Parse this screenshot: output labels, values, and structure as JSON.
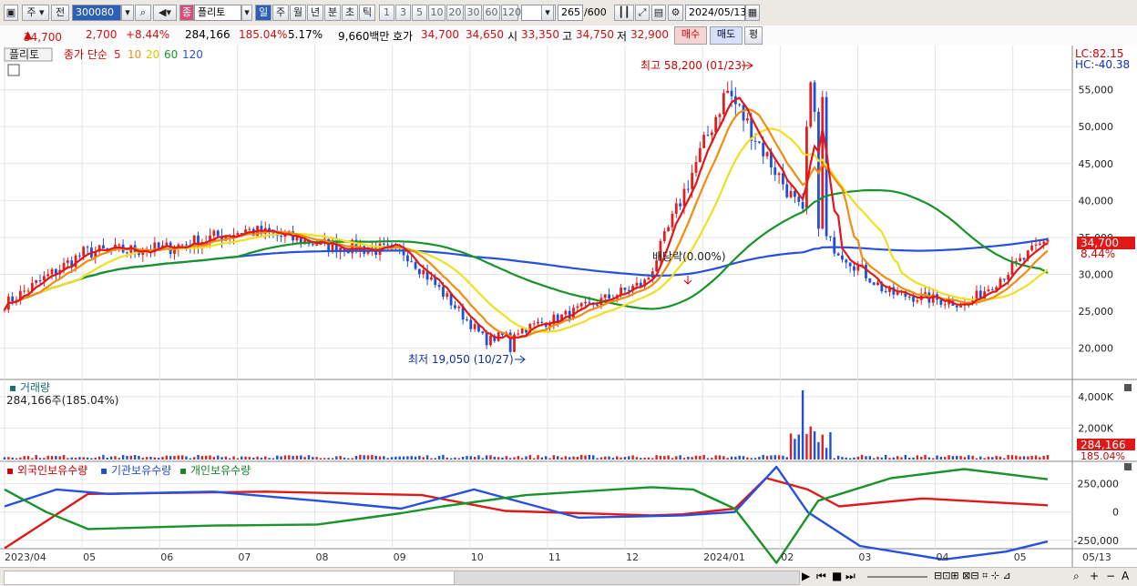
{
  "toolbar": {
    "type_label": "주",
    "prev_label": "전",
    "code": "300080",
    "stock_name_tag": "종",
    "stock_name": "플리토",
    "periods": [
      "일",
      "주",
      "월",
      "년",
      "분",
      "초",
      "틱"
    ],
    "numbers": [
      "1",
      "3",
      "5",
      "10",
      "20",
      "30",
      "60",
      "120"
    ],
    "count": "265",
    "count_total": "/600",
    "date": "2024/05/13"
  },
  "info": {
    "price": "34,700",
    "change": "2,700",
    "change_pct": "+8.44%",
    "volume": "284,166",
    "vol_ratio": "185.04%",
    "turnover": "5.17%",
    "amount": "9,660백만",
    "quote_label": "호가",
    "ask": "34,700",
    "bid": "34,650",
    "open_label": "시",
    "open": "33,350",
    "high_label": "고",
    "high": "34,750",
    "low_label": "저",
    "low": "32,900",
    "buy_label": "매수",
    "sell_label": "매도",
    "eval_label": "평"
  },
  "legend": {
    "name": "플리토",
    "ma_prefix": "종가 단순",
    "ma5": "5",
    "ma10": "10",
    "ma20": "20",
    "ma60": "60",
    "ma120": "120"
  },
  "annotations": {
    "high": "최고 58,200 (01/23)",
    "low": "최저 19,050 (10/27)",
    "dividend": "배당락(0.00%)",
    "lc": "LC:82.15",
    "hc": "HC:-40.38",
    "price_tag": "34,700",
    "pct_tag": "8.44%"
  },
  "volume_panel": {
    "title": "거래량",
    "value": "284,166주(185.04%)",
    "tag": "284,166",
    "tag2": "185.04%",
    "ticks": [
      "4,000K",
      "2,000K"
    ]
  },
  "holdings_panel": {
    "foreign": "외국인보유수량",
    "inst": "기관보유수량",
    "retail": "개인보유수량",
    "ticks": [
      "250,000",
      "0",
      "-250,000"
    ]
  },
  "price_ticks": [
    "55,000",
    "50,000",
    "45,000",
    "40,000",
    "35,000",
    "30,000",
    "25,000",
    "20,000"
  ],
  "xaxis": [
    "2023/04",
    "05",
    "06",
    "07",
    "08",
    "09",
    "10",
    "11",
    "12",
    "2024/01",
    "02",
    "03",
    "04",
    "05",
    "05/13"
  ],
  "colors": {
    "up": "#e02020",
    "down": "#1f4fd8",
    "ma5": "#e01818",
    "ma10": "#f08c10",
    "ma20": "#f0e020",
    "ma60": "#18942a",
    "ma120": "#2850e0"
  },
  "chart_data": {
    "type": "candlestick",
    "title": "플리토",
    "date_range": [
      "2023/04",
      "2024/05/13"
    ],
    "close_approx": [
      {
        "month": "2023/04",
        "close": 26000
      },
      {
        "month": "2023/05",
        "close": 33000
      },
      {
        "month": "2023/06",
        "close": 33500
      },
      {
        "month": "2023/07",
        "close": 36000
      },
      {
        "month": "2023/08",
        "close": 34000
      },
      {
        "month": "2023/09",
        "close": 33000
      },
      {
        "month": "2023/10",
        "close": 21000
      },
      {
        "month": "2023/11",
        "close": 24500
      },
      {
        "month": "2023/12",
        "close": 29000
      },
      {
        "month": "2024/01",
        "close": 55000
      },
      {
        "month": "2024/02",
        "close": 37000
      },
      {
        "month": "2024/03",
        "close": 27500
      },
      {
        "month": "2024/04",
        "close": 26000
      },
      {
        "month": "2024/05",
        "close": 34700
      }
    ],
    "high": 58200,
    "low": 19050,
    "y_range": [
      17500,
      60000
    ],
    "volume_peak_k": 4400,
    "holdings_series": [
      "외국인보유수량",
      "기관보유수량",
      "개인보유수량"
    ],
    "holdings_range": [
      -300000,
      400000
    ]
  }
}
